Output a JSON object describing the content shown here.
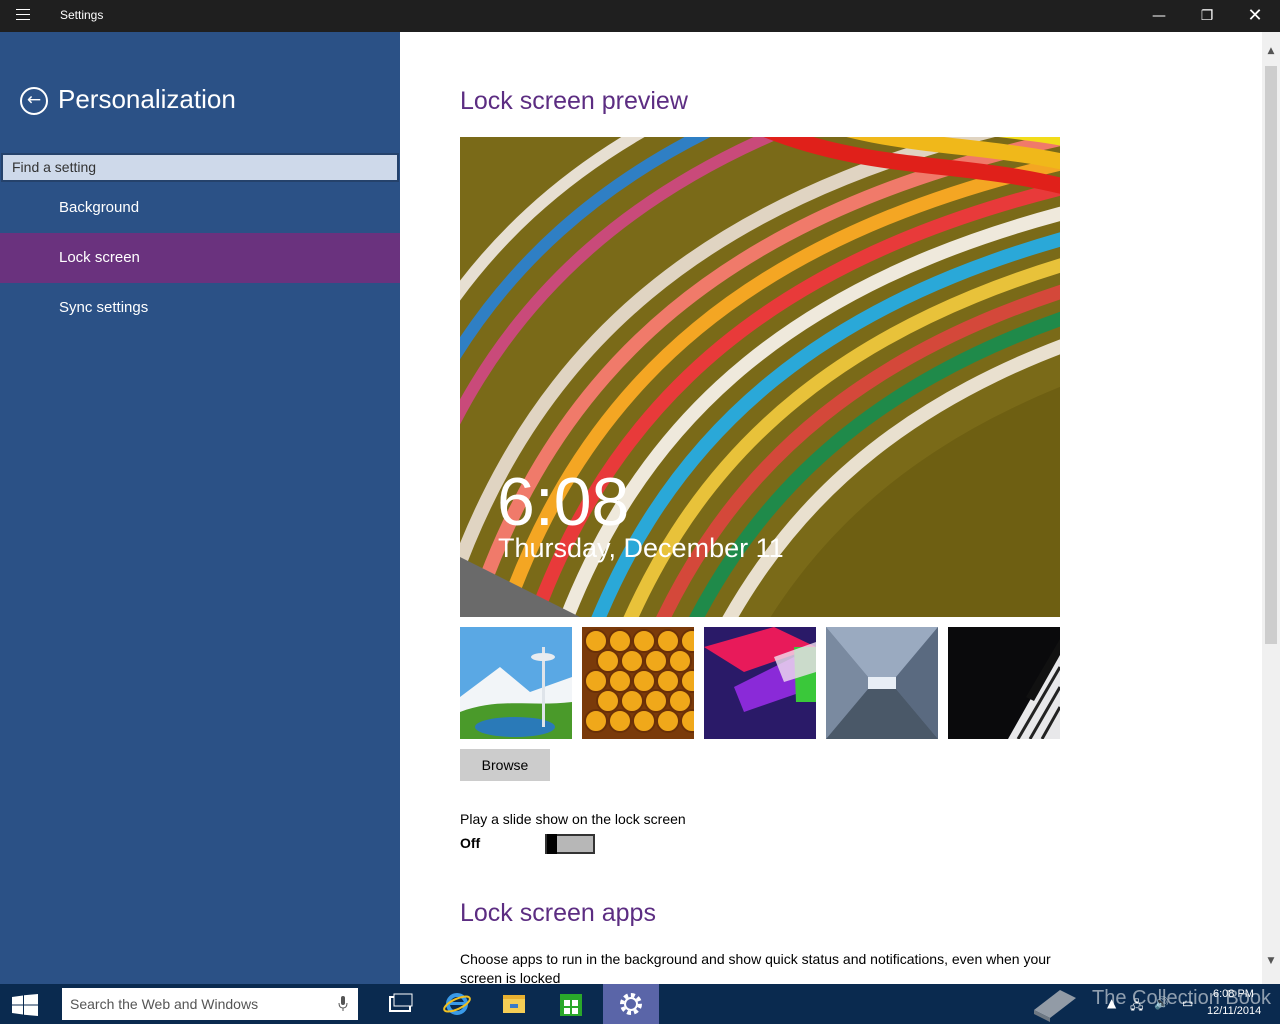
{
  "window": {
    "title": "Settings",
    "minimize": "—",
    "maximize": "❐",
    "close": "✕"
  },
  "sidebar": {
    "section_title": "Personalization",
    "search_placeholder": "Find a setting",
    "items": [
      {
        "label": "Background",
        "active": false
      },
      {
        "label": "Lock screen",
        "active": true
      },
      {
        "label": "Sync settings",
        "active": false
      }
    ]
  },
  "main": {
    "preview_heading": "Lock screen preview",
    "preview_time": "6:08",
    "preview_date": "Thursday, December 11",
    "browse_label": "Browse",
    "slideshow_label": "Play a slide show on the lock screen",
    "slideshow_state": "Off",
    "apps_heading": "Lock screen apps",
    "apps_description": "Choose apps to run in the background and show quick status and notifications, even when your screen is locked"
  },
  "taskbar": {
    "search_placeholder": "Search the Web and Windows",
    "time": "6:08 PM",
    "date": "12/11/2014",
    "watermark": "The Collection Book"
  },
  "colors": {
    "sidebar_bg": "#2b5186",
    "sidebar_active": "#6a327e",
    "heading_accent": "#5c2d82",
    "taskbar_bg": "#0a2a4f",
    "titlebar_bg": "#1f1f1f"
  }
}
